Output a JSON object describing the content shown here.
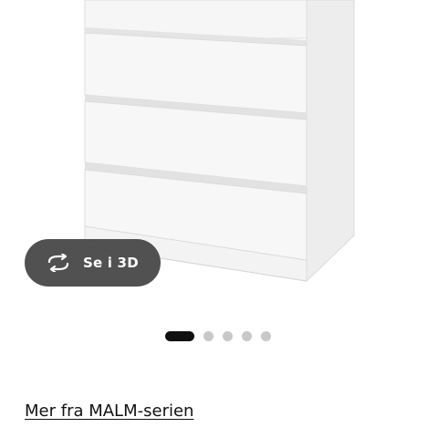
{
  "product": {
    "image_icon": "dresser-image"
  },
  "view_3d": {
    "icon": "rotate-arrows-icon",
    "label": "Se i 3D"
  },
  "carousel": {
    "total_slides": 5,
    "active_index": 0
  },
  "series_link": {
    "label": "Mer fra MALM-serien"
  }
}
